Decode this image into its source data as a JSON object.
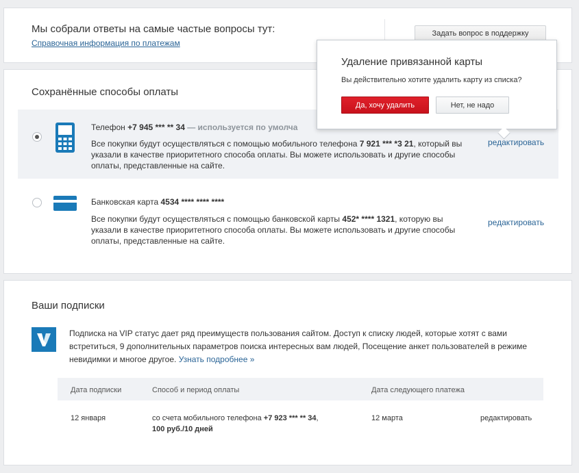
{
  "faq": {
    "title": "Мы собрали ответы на самые частые вопросы тут:",
    "link": "Справочная информация по платежам",
    "support_button": "Задать вопрос в поддержку"
  },
  "methods": {
    "title": "Сохранённые способы оплаты",
    "phone": {
      "label": "Телефон",
      "number": "+7 945 *** ** 34",
      "status": "— используется по умолча",
      "desc_1": "Все покупки будут осуществляться с помощью мобильного телефона ",
      "desc_num": "7 921 *** *3 21",
      "desc_2": ", который вы указали в качестве приоритетного способа оплаты. Вы можете использовать и другие способы оплаты, представленные на сайте.",
      "edit": "редактировать",
      "selected": true
    },
    "card": {
      "label": "Банковская карта",
      "number": "4534 **** **** ****",
      "desc_1": "Все покупки будут осуществляться с помощью банковской карты ",
      "desc_num": "452* **** 1321",
      "desc_2": ", которую вы указали в качестве приоритетного способа оплаты. Вы можете использовать и другие способы оплаты, представленные на сайте.",
      "edit": "редактировать",
      "selected": false
    }
  },
  "popup": {
    "title": "Удаление привязанной карты",
    "message": "Вы действительно хотите удалить карту из списка?",
    "confirm": "Да, хочу удалить",
    "cancel": "Нет, не надо"
  },
  "subscriptions": {
    "title": "Ваши подписки",
    "vip_text": "Подписка на VIP статус дает ряд преимуществ пользования сайтом. Доступ к списку людей, которые хотят с вами встретиться, 9 дополнительных параметров поиска интересных вам людей, Посещение анкет пользователей в режиме невидимки и многое другое. ",
    "vip_more": "Узнать подробнее »",
    "headers": [
      "Дата подписки",
      "Способ и период оплаты",
      "Дата следующего платежа"
    ],
    "row": {
      "date": "12 января",
      "method_1": "со счета мобильного телефона ",
      "method_num": "+7 923 *** ** 34",
      "method_2": ",",
      "period": "100 руб./10 дней",
      "next_date": "12 марта",
      "edit": "редактировать"
    }
  },
  "colors": {
    "accent_blue": "#2a6496",
    "confirm_red": "#d4141e",
    "vip_blue": "#1a7ab8"
  }
}
